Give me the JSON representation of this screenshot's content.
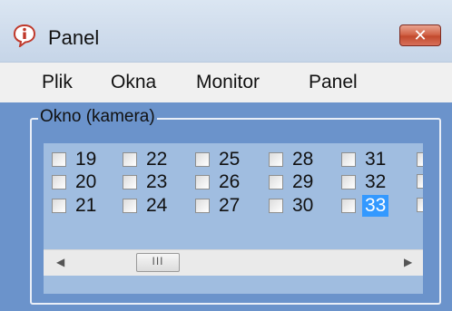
{
  "window": {
    "title": "Panel",
    "close_glyph": "✕",
    "icon": "info-icon"
  },
  "menu": {
    "items": [
      "Plik",
      "Okna",
      "Monitor",
      "Panel"
    ]
  },
  "group": {
    "label": "Okno (kamera)"
  },
  "cameras": {
    "columns": [
      [
        "19",
        "20",
        "21"
      ],
      [
        "22",
        "23",
        "24"
      ],
      [
        "25",
        "26",
        "27"
      ],
      [
        "28",
        "29",
        "30"
      ],
      [
        "31",
        "32",
        "33"
      ]
    ],
    "selected": "33"
  },
  "scrollbar": {
    "left_arrow": "◀",
    "right_arrow": "▶",
    "thumb_grip": "III"
  },
  "colors": {
    "client_bg": "#6b93cb",
    "list_bg": "#a0bde0",
    "selection": "#3399ff"
  }
}
